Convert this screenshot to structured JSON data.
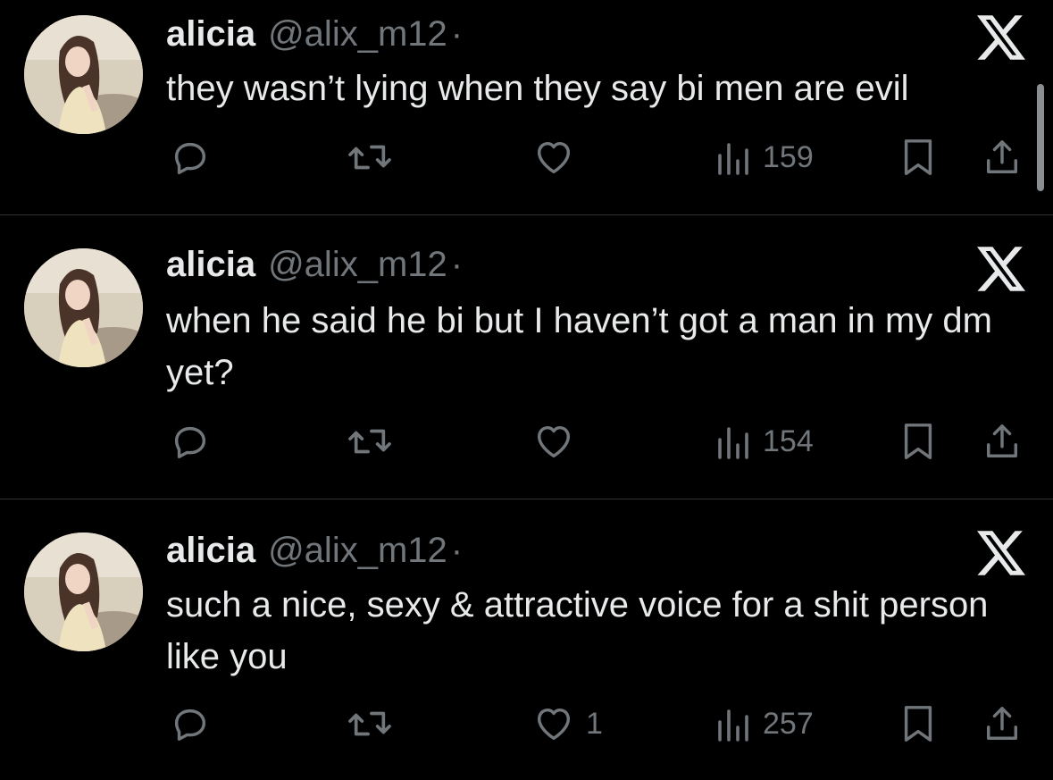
{
  "tweets": [
    {
      "name": "alicia",
      "handle": "@alix_m12",
      "separator": "·",
      "text": "they wasn’t lying when they say bi men are evil",
      "likes": "",
      "views": "159"
    },
    {
      "name": "alicia",
      "handle": "@alix_m12",
      "separator": "·",
      "text": "when he said he bi but I haven’t got a man in my dm yet?",
      "likes": "",
      "views": "154"
    },
    {
      "name": "alicia",
      "handle": "@alix_m12",
      "separator": "·",
      "text": "such a nice, sexy & attractive voice for a shit person like you",
      "likes": "1",
      "views": "257"
    }
  ],
  "icons": {
    "reply": "reply-icon",
    "retweet": "retweet-icon",
    "like": "heart-icon",
    "views": "views-icon",
    "bookmark": "bookmark-icon",
    "share": "share-icon",
    "brand": "x-logo-icon"
  },
  "colors": {
    "background": "#000000",
    "text_primary": "#e7e9ea",
    "text_secondary": "#71767b",
    "divider": "#2f3336"
  }
}
